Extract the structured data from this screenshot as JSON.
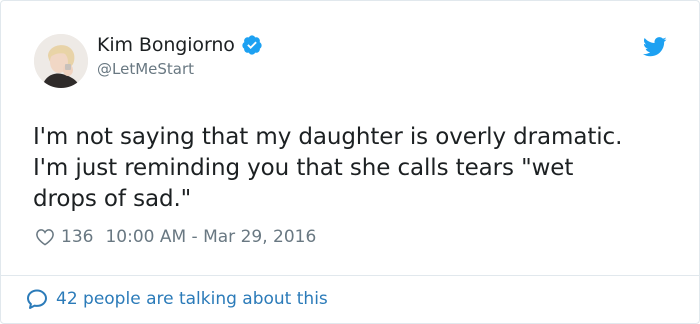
{
  "tweet": {
    "author": {
      "name": "Kim Bongiorno",
      "handle": "@LetMeStart",
      "verified": true
    },
    "text_lines": [
      "I'm not saying that my daughter is overly dramatic.",
      "I'm just reminding you that she calls tears \"wet",
      "drops of sad.\""
    ],
    "likes": "136",
    "timestamp": "10:00 AM - Mar 29, 2016",
    "footer_text": "42 people are talking about this"
  },
  "icons": {
    "verified": "verified-badge-icon",
    "twitter": "twitter-bird-icon",
    "like": "heart-icon",
    "comment": "comment-bubble-icon"
  },
  "colors": {
    "twitter_blue": "#1da1f2",
    "link_blue": "#2b7bb9",
    "text": "#1c2022",
    "muted": "#697882"
  }
}
